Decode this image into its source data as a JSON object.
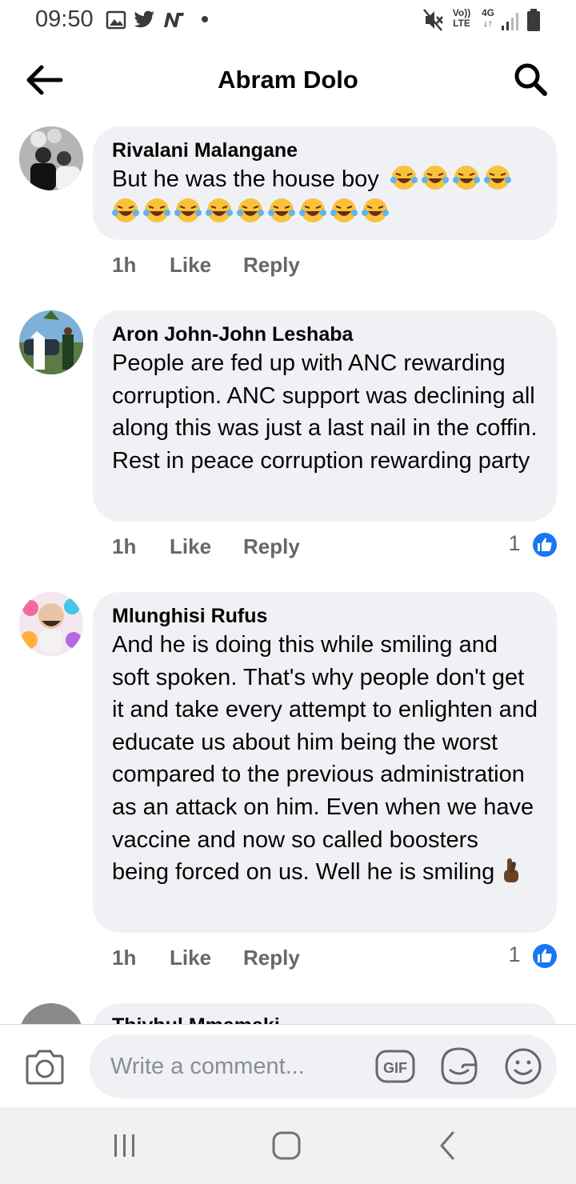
{
  "status_bar": {
    "time": "09:50",
    "left_icons": [
      "gallery-icon",
      "twitter-icon",
      "n-app-icon",
      "dot-icon"
    ],
    "right_icons": [
      "mute-icon",
      "volte-icon",
      "4g-icon",
      "signal-icon",
      "battery-icon"
    ],
    "volte_label_top": "Vo))",
    "volte_label_bottom": "LTE",
    "network_label": "4G"
  },
  "header": {
    "title": "Abram Dolo"
  },
  "comments": [
    {
      "author": "Rivalani Malangane",
      "text": "But he was the house boy",
      "emoji_count_line1": 4,
      "emoji_count_line2": 9,
      "time": "1h",
      "like_label": "Like",
      "reply_label": "Reply",
      "reactions": ""
    },
    {
      "author": "Aron John-John Leshaba",
      "text": "People are fed up with ANC rewarding corruption. ANC support was declining all along this was just a last nail in the coffin. Rest in peace corruption rewarding party",
      "time": "1h",
      "like_label": "Like",
      "reply_label": "Reply",
      "reactions": "1"
    },
    {
      "author": "Mlunghisi Rufus",
      "text": "And he is doing this while smiling and soft spoken. That's why people don't get it and take every attempt to enlighten and educate us about him being the worst compared to the previous administration as an attack on him. Even when we have vaccine and now so called boosters being forced on us. Well he is smiling",
      "time": "1h",
      "like_label": "Like",
      "reply_label": "Reply",
      "reactions": "1"
    }
  ],
  "partial_comment_author": "Thivhul Mmamaki",
  "composer": {
    "placeholder": "Write a comment..."
  },
  "colors": {
    "bubble": "#eff1f4",
    "like_blue": "#1877f2",
    "meta_gray": "#65676b"
  }
}
